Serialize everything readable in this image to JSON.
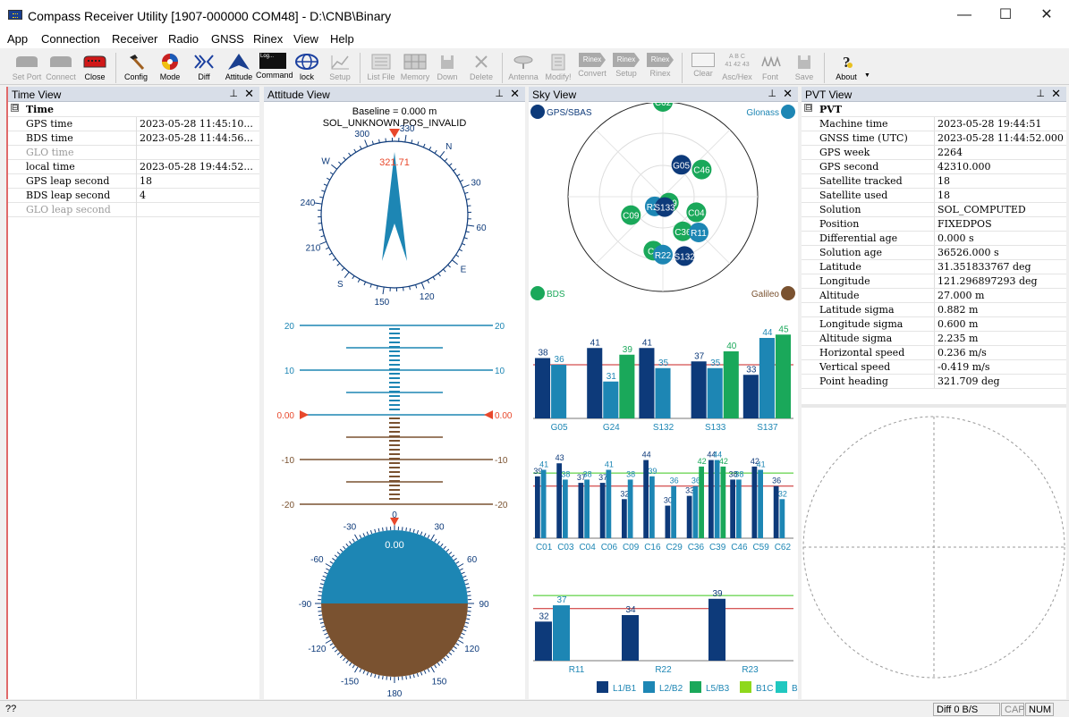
{
  "window": {
    "title": "Compass Receiver Utility [1907-000000 COM48] - D:\\CNB\\Binary",
    "minimize": "—",
    "maximize": "☐",
    "close": "✕"
  },
  "menu": [
    "App",
    "Connection",
    "Receiver",
    "Radio",
    "GNSS",
    "Rinex",
    "View",
    "Help"
  ],
  "toolbar": {
    "buttons": [
      {
        "label": "Set Port",
        "enabled": false
      },
      {
        "label": "Connect",
        "enabled": false
      },
      {
        "label": "Close",
        "enabled": true
      },
      {
        "label": "Config",
        "enabled": true
      },
      {
        "label": "Mode",
        "enabled": true
      },
      {
        "label": "Diff",
        "enabled": true
      },
      {
        "label": "Attitude",
        "enabled": true
      },
      {
        "label": "Command",
        "enabled": true
      },
      {
        "label": "lock",
        "enabled": true
      },
      {
        "label": "Setup",
        "enabled": false
      },
      {
        "label": "List File",
        "enabled": false
      },
      {
        "label": "Memory",
        "enabled": false
      },
      {
        "label": "Down",
        "enabled": false
      },
      {
        "label": "Delete",
        "enabled": false
      },
      {
        "label": "Antenna",
        "enabled": false
      },
      {
        "label": "Modify!",
        "enabled": false
      },
      {
        "label": "Convert",
        "enabled": false
      },
      {
        "label": "Setup",
        "enabled": false
      },
      {
        "label": "Rinex",
        "enabled": false
      },
      {
        "label": "Clear",
        "enabled": false
      },
      {
        "label": "Asc/Hex",
        "enabled": false
      },
      {
        "label": "Font",
        "enabled": false
      },
      {
        "label": "Save",
        "enabled": false
      },
      {
        "label": "About",
        "enabled": true
      }
    ],
    "command_icon_text": "Log...",
    "rinex_icon_text": "Rinex",
    "ascii_icon_text": "A B C\n41 42 43"
  },
  "time_view": {
    "title": "Time View",
    "pin": "📌",
    "close": "✕",
    "section": "Time",
    "section_toggle": "⊟",
    "rows": [
      {
        "name": "GPS time",
        "value": "2023-05-28 11:45:10...",
        "dim": false
      },
      {
        "name": "BDS time",
        "value": "2023-05-28 11:44:56...",
        "dim": false
      },
      {
        "name": "GLO time",
        "value": "",
        "dim": true
      },
      {
        "name": "local time",
        "value": "2023-05-28 19:44:52...",
        "dim": false
      },
      {
        "name": "GPS leap second",
        "value": "18",
        "dim": false
      },
      {
        "name": "BDS leap second",
        "value": "4",
        "dim": false
      },
      {
        "name": "GLO leap second",
        "value": "",
        "dim": true
      }
    ]
  },
  "attitude_view": {
    "title": "Attitude View",
    "baseline": "Baseline = 0.000 m",
    "solution": "SOL_UNKNOWN POS_INVALID",
    "heading_value": "321.71",
    "heading_deg": 321.71,
    "compass_labels": [
      "N",
      "30",
      "60",
      "E",
      "120",
      "150",
      "S",
      "210",
      "240",
      "W",
      "300",
      "330"
    ],
    "pitch_scale": [
      "20",
      "10",
      "0.00",
      "-10",
      "-20"
    ],
    "pitch_value": "0.00",
    "roll_labels": [
      "0",
      "30",
      "60",
      "90",
      "120",
      "150",
      "180",
      "-150",
      "-120",
      "-90",
      "-60",
      "-30"
    ],
    "roll_value": "0.00"
  },
  "sky_view": {
    "title": "Sky View",
    "legend_corners": {
      "top_left": "GPS/SBAS",
      "top_right": "Glonass",
      "bottom_left": "BDS",
      "bottom_right": "Galileo"
    },
    "satellites": [
      {
        "id": "C62",
        "system": "BDS",
        "az": 0,
        "el": 0
      },
      {
        "id": "G05",
        "system": "GPS",
        "az": 30,
        "el": 55
      },
      {
        "id": "C46",
        "system": "BDS",
        "az": 55,
        "el": 45
      },
      {
        "id": "R23",
        "system": "GLO",
        "az": 220,
        "el": 78
      },
      {
        "id": "C59",
        "system": "BDS",
        "az": 135,
        "el": 82
      },
      {
        "id": "C04",
        "system": "BDS",
        "az": 115,
        "el": 55
      },
      {
        "id": "S133",
        "system": "GPS",
        "az": 170,
        "el": 80
      },
      {
        "id": "C09",
        "system": "BDS",
        "az": 240,
        "el": 55
      },
      {
        "id": "C36",
        "system": "BDS",
        "az": 150,
        "el": 52
      },
      {
        "id": "R11",
        "system": "GLO",
        "az": 135,
        "el": 42
      },
      {
        "id": "C2",
        "system": "BDS",
        "az": 190,
        "el": 38
      },
      {
        "id": "R22",
        "system": "GLO",
        "az": 180,
        "el": 35
      },
      {
        "id": "S132",
        "system": "GPS",
        "az": 160,
        "el": 30
      }
    ],
    "snr_charts": [
      {
        "categories": [
          "G05",
          "G24",
          "S132",
          "S133",
          "S137"
        ],
        "series": [
          [
            38,
            41,
            41,
            37,
            33
          ],
          [
            36,
            31,
            35,
            35,
            44
          ],
          [
            null,
            39,
            null,
            40,
            45
          ]
        ],
        "mask": [
          36
        ]
      },
      {
        "categories": [
          "C01",
          "C03",
          "C04",
          "C06",
          "C09",
          "C16",
          "C29",
          "C36",
          "C39",
          "C46",
          "C59",
          "C62"
        ],
        "series": [
          [
            39,
            43,
            37,
            37,
            32,
            44,
            30,
            33,
            44,
            38,
            42,
            36
          ],
          [
            41,
            38,
            38,
            41,
            38,
            39,
            36,
            36,
            44,
            38,
            41,
            32
          ],
          [
            null,
            null,
            null,
            null,
            null,
            null,
            null,
            42,
            42,
            null,
            null,
            null
          ]
        ],
        "mask": [
          36,
          40
        ]
      },
      {
        "categories": [
          "R11",
          "R22",
          "R23"
        ],
        "series": [
          [
            32,
            34,
            39
          ],
          [
            37,
            null,
            null
          ],
          [
            null,
            null,
            null
          ]
        ],
        "mask": [
          36,
          40
        ]
      }
    ],
    "signal_legend": [
      "L1/B1",
      "L2/B2",
      "L5/B3",
      "B1C",
      "B"
    ]
  },
  "pvt_view": {
    "title": "PVT View",
    "section": "PVT",
    "section_toggle": "⊟",
    "rows": [
      {
        "name": "Machine time",
        "value": "2023-05-28 19:44:51"
      },
      {
        "name": "GNSS time (UTC)",
        "value": "2023-05-28 11:44:52.000"
      },
      {
        "name": "GPS week",
        "value": "2264"
      },
      {
        "name": "GPS second",
        "value": "42310.000"
      },
      {
        "name": "Satellite tracked",
        "value": "18"
      },
      {
        "name": "Satellite used",
        "value": "18"
      },
      {
        "name": "Solution",
        "value": "SOL_COMPUTED"
      },
      {
        "name": "Position",
        "value": "FIXEDPOS"
      },
      {
        "name": "Differential age",
        "value": "0.000 s"
      },
      {
        "name": "Solution age",
        "value": "36526.000 s"
      },
      {
        "name": "Latitude",
        "value": "31.351833767 deg"
      },
      {
        "name": "Longitude",
        "value": "121.296897293 deg"
      },
      {
        "name": "Altitude",
        "value": "27.000 m"
      },
      {
        "name": "Latitude sigma",
        "value": "0.882 m"
      },
      {
        "name": "Longitude sigma",
        "value": "0.600 m"
      },
      {
        "name": "Altitude sigma",
        "value": "2.235 m"
      },
      {
        "name": "Horizontal speed",
        "value": "0.236 m/s"
      },
      {
        "name": "Vertical speed",
        "value": "-0.419 m/s"
      },
      {
        "name": "Point heading",
        "value": "321.709 deg"
      }
    ]
  },
  "status": {
    "left": "??",
    "diff": "Diff 0 B/S",
    "cap": "CAP",
    "num": "NUM"
  },
  "colors": {
    "gps": "#0d3a7a",
    "glo": "#1d86b4",
    "bds": "#1aa85a",
    "gal": "#7a5230",
    "b1c": "#8ed81c",
    "b": "#20c8c0",
    "sky": "#1d86b4",
    "ground": "#7a5230",
    "accent": "#e8482c"
  }
}
